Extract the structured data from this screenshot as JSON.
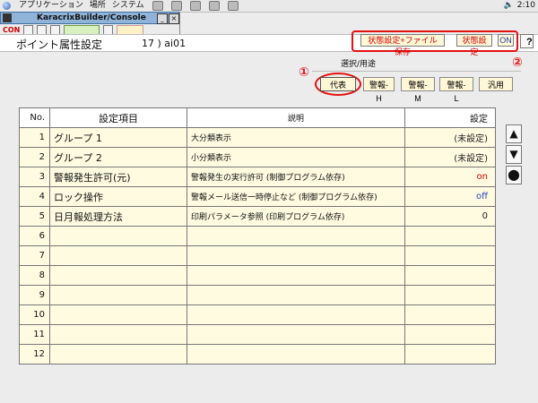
{
  "system_bar": {
    "menus": [
      "アプリケーション",
      "場所",
      "システム"
    ],
    "time": "2:10"
  },
  "mini_window": {
    "title": "KaracrixBuilder/Console",
    "status": "CON"
  },
  "header": {
    "title": "ポイント属性設定",
    "point": "17 ) ai01",
    "buttons": {
      "save_label": "状態設定+ファイル保存",
      "state_label": "状態設定",
      "on_label": "ON",
      "help_label": "?"
    }
  },
  "annotations": {
    "first": "①",
    "second": "②"
  },
  "purpose": {
    "label": "選択/用途",
    "tabs": [
      "代表",
      "警報-H",
      "警報-M",
      "警報-L",
      "汎用"
    ]
  },
  "table": {
    "headers": [
      "No.",
      "設定項目",
      "説明",
      "設定"
    ],
    "rows": [
      {
        "no": "1",
        "item": "グループ 1",
        "desc": "大分類表示",
        "value": "(未設定)",
        "status": "dark"
      },
      {
        "no": "2",
        "item": "グループ 2",
        "desc": "小分類表示",
        "value": "(未設定)",
        "status": "dark"
      },
      {
        "no": "3",
        "item": "警報発生許可(元)",
        "desc": "警報発生の実行許可 (制御プログラム依存)",
        "value": "on",
        "status": "on"
      },
      {
        "no": "4",
        "item": "ロック操作",
        "desc": "警報メール送信一時停止など (制御プログラム依存)",
        "value": "off",
        "status": "off"
      },
      {
        "no": "5",
        "item": "日月報処理方法",
        "desc": "印刷パラメータ参照 (印刷プログラム依存)",
        "value": "0",
        "status": "dark"
      },
      {
        "no": "6",
        "item": "",
        "desc": "",
        "value": "",
        "status": "dark"
      },
      {
        "no": "7",
        "item": "",
        "desc": "",
        "value": "",
        "status": "dark"
      },
      {
        "no": "8",
        "item": "",
        "desc": "",
        "value": "",
        "status": "dark"
      },
      {
        "no": "9",
        "item": "",
        "desc": "",
        "value": "",
        "status": "dark"
      },
      {
        "no": "10",
        "item": "",
        "desc": "",
        "value": "",
        "status": "dark"
      },
      {
        "no": "11",
        "item": "",
        "desc": "",
        "value": "",
        "status": "dark"
      },
      {
        "no": "12",
        "item": "",
        "desc": "",
        "value": "",
        "status": "dark"
      }
    ]
  },
  "side_controls": [
    "▲",
    "▼",
    "●"
  ]
}
